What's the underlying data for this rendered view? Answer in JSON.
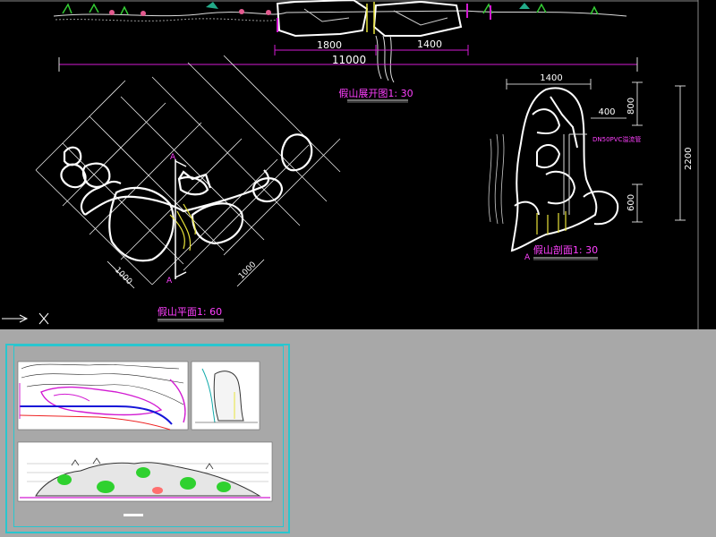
{
  "elevation": {
    "dim_total": "11000",
    "dim_left": "1800",
    "dim_right": "1400",
    "title": "假山展开图1: 30"
  },
  "plan": {
    "title": "假山平面1: 60",
    "section_mark_top": "A",
    "section_mark_bottom": "A",
    "dim_left": "1000",
    "dim_right": "1000"
  },
  "section": {
    "title": "假山剖面1: 30",
    "section_mark": "A",
    "dim_top": "1400",
    "dim_inner": "400",
    "dim_v1": "800",
    "dim_v2": "2200",
    "dim_v3": "600",
    "note": "DN50PVC溢流管"
  },
  "colors": {
    "background": "#000000",
    "linework": "#ffffff",
    "dimension": "#d21ad2",
    "text_label": "#ff40ff",
    "frame": "#29c6cf",
    "panel": "#a8a8a8"
  }
}
